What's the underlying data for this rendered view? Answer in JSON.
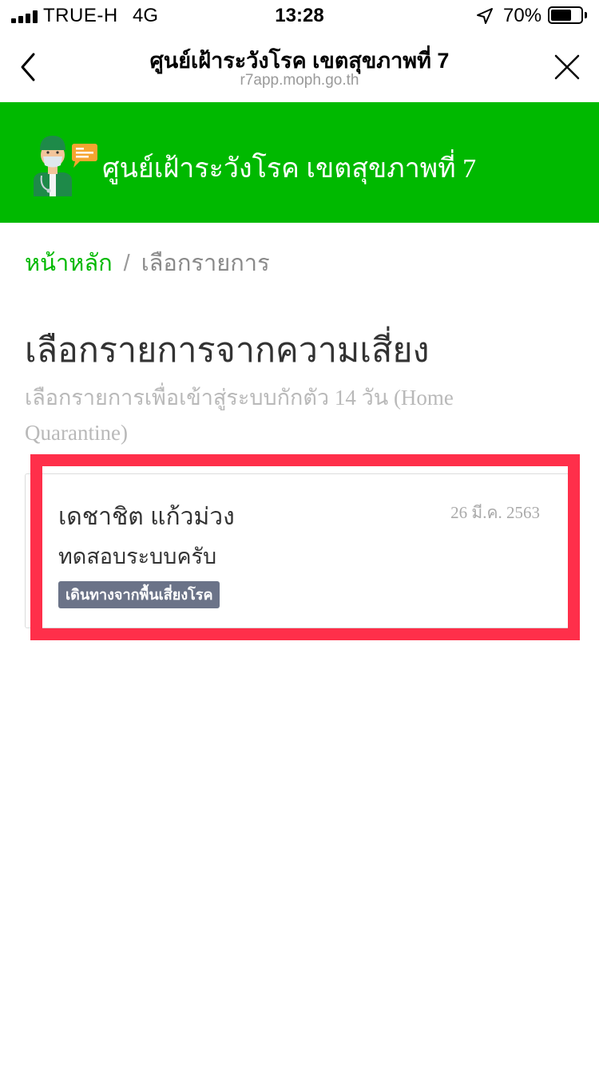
{
  "status_bar": {
    "carrier": "TRUE-H",
    "network": "4G",
    "time": "13:28",
    "battery_percent": "70%",
    "battery_level": 0.7,
    "icons": [
      "signal-icon",
      "location-arrow-icon",
      "battery-icon"
    ]
  },
  "nav": {
    "title": "ศูนย์เฝ้าระวังโรค เขตสุขภาพที่ 7",
    "url": "r7app.moph.go.th",
    "icons": [
      "back-chevron-icon",
      "close-icon"
    ]
  },
  "banner": {
    "title": "ศูนย์เฝ้าระวังโรค เขตสุขภาพที่ 7",
    "logo_icon": "health-worker-logo-icon",
    "background_color": "#00b900"
  },
  "breadcrumb": {
    "home": "หน้าหลัก",
    "separator": "/",
    "current": "เลือกรายการ"
  },
  "page": {
    "title": "เลือกรายการจากความเสี่ยง",
    "subtitle": "เลือกรายการเพื่อเข้าสู่ระบบกักตัว 14 วัน (Home Quarantine)"
  },
  "items": [
    {
      "name": "เดชาชิต แก้วม่วง",
      "date": "26 มี.ค. 2563",
      "description": "ทดสอบระบบครับ",
      "badge": "เดินทางจากพื้นเสี่ยงโรค"
    }
  ],
  "colors": {
    "accent": "#00b900",
    "badge": "#6b7388",
    "highlight": "#ff2f4a"
  }
}
